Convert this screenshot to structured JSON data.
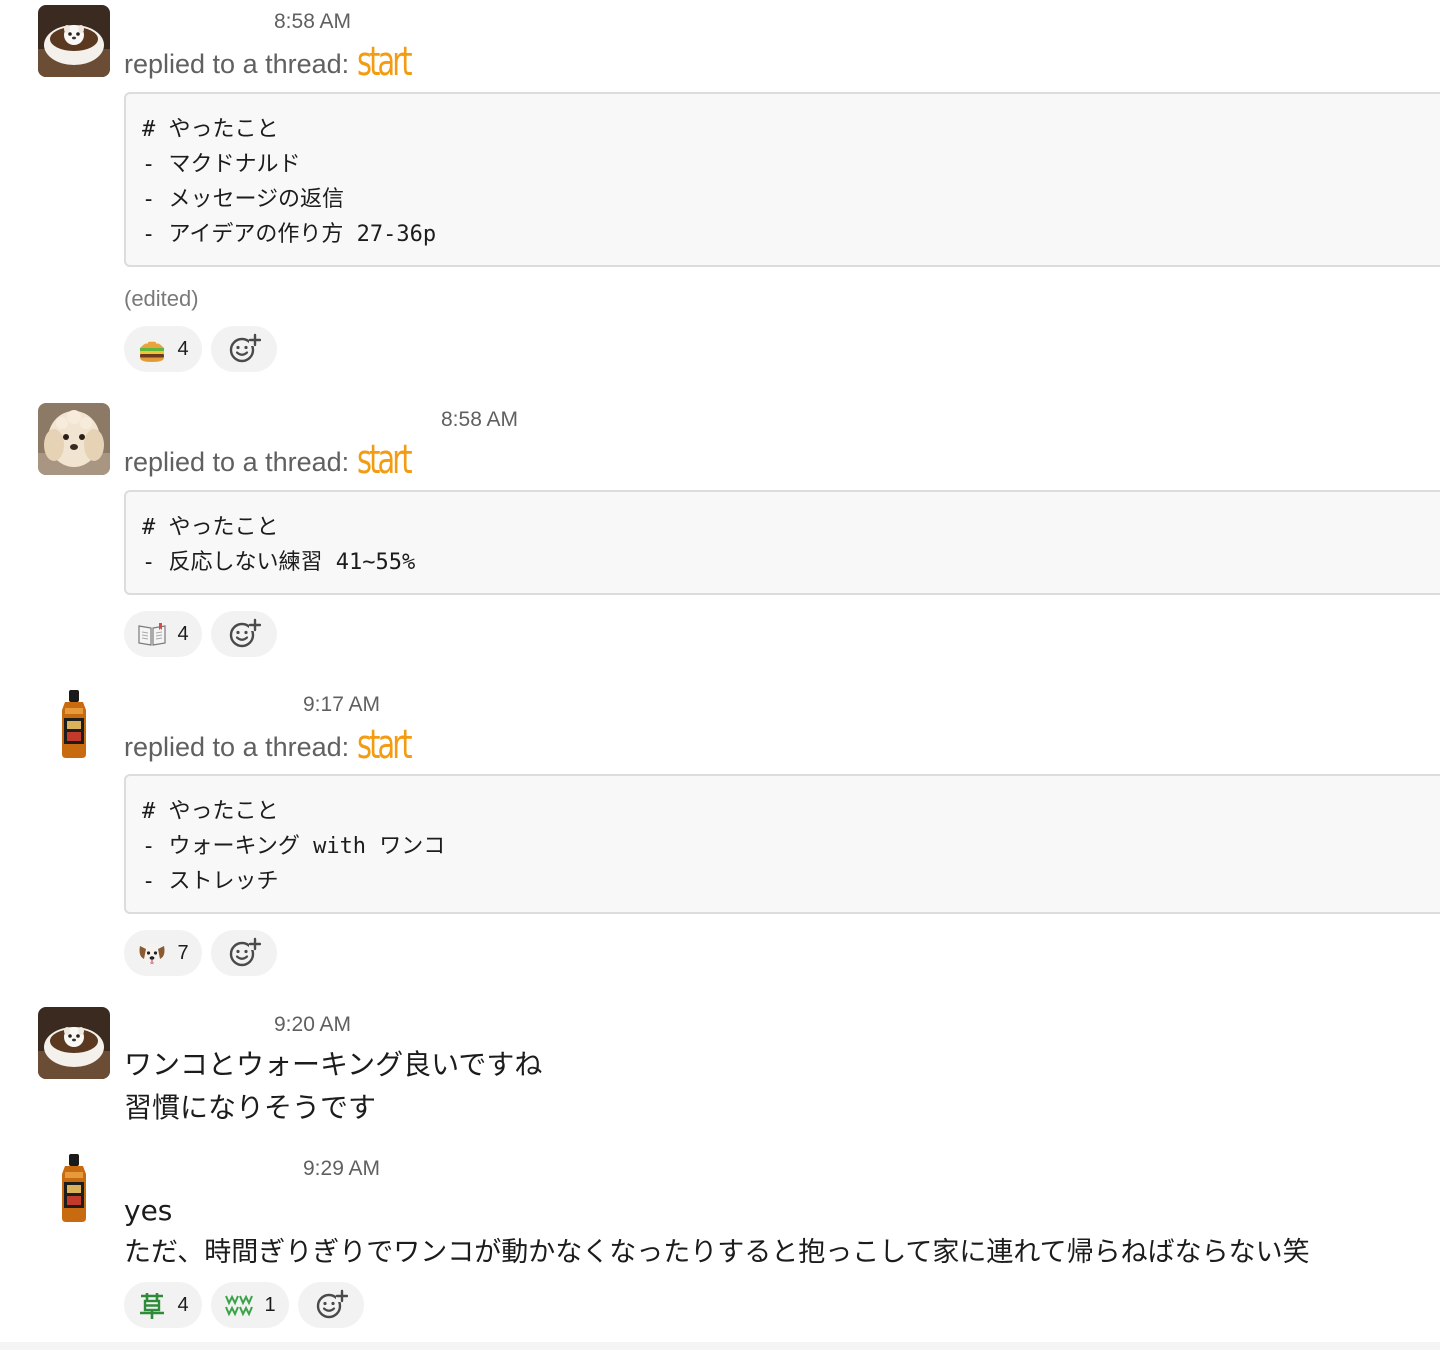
{
  "messages": [
    {
      "author": "",
      "time": "8:58 AM",
      "thread_prefix": "replied to a thread:",
      "thread_link": "start",
      "code_lines": [
        "# やったこと",
        "- マクドナルド",
        "- メッセージの返信",
        "- アイデアの作り方 27-36p"
      ],
      "edited": "(edited)",
      "reactions": [
        {
          "emoji": "hamburger-emoji",
          "count": "4"
        }
      ]
    },
    {
      "author": "",
      "time": "8:58 AM",
      "thread_prefix": "replied to a thread:",
      "thread_link": "start",
      "code_lines": [
        "# やったこと",
        "- 反応しない練習 41~55%"
      ],
      "reactions": [
        {
          "emoji": "open-book-emoji",
          "count": "4"
        }
      ]
    },
    {
      "author": "",
      "time": "9:17 AM",
      "thread_prefix": "replied to a thread:",
      "thread_link": "start",
      "code_lines": [
        "# やったこと",
        "- ウォーキング with ワンコ",
        "- ストレッチ"
      ],
      "reactions": [
        {
          "emoji": "dog-face-emoji",
          "count": "7"
        }
      ]
    },
    {
      "author": "",
      "time": "9:20 AM",
      "lines": [
        "ワンコとウォーキング良いですね",
        "習慣になりそうです"
      ]
    },
    {
      "author": "",
      "time": "9:29 AM",
      "lines": [
        "yes",
        "ただ、時間ぎりぎりでワンコが動かなくなったりすると抱っこして家に連れて帰らねばならない笑"
      ],
      "reactions": [
        {
          "emoji": "kusa-emoji",
          "count": "4"
        },
        {
          "emoji": "wwww-emoji",
          "count": "1"
        }
      ]
    }
  ],
  "colors": {
    "thread_link": "#f39c12",
    "muted_text": "#616061",
    "code_bg": "#f8f8f8",
    "reaction_bg": "#f2f2f2"
  }
}
